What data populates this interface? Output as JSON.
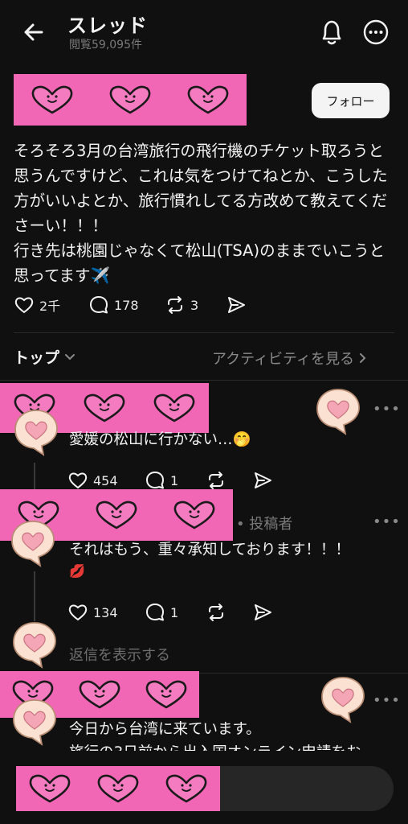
{
  "header": {
    "title": "スレッド",
    "subtitle": "閲覧59,095件"
  },
  "post": {
    "follow_label": "フォロー",
    "text": "そろそろ3月の台湾旅行の飛行機のチケット取ろうと思うんですけど、これは気をつけてねとか、こうした方がいいよとか、旅行慣れしてる方改めて教えてくださーい！！！\n行き先は桃園じゃなくて松山(TSA)のままでいこうと思ってます✈️",
    "likes": "2千",
    "replies": "178",
    "reposts": "3"
  },
  "sort_bar": {
    "top_label": "トップ",
    "activity_label": "アクティビティを見る"
  },
  "replies": [
    {
      "text": "愛媛の松山に行かない…🤭",
      "likes": "454",
      "comments": "1"
    },
    {
      "author_tag": "• 投稿者",
      "text": "それはもう、重々承知しております！！！",
      "emoji": "💋",
      "likes": "134",
      "comments": "1",
      "show_replies": "返信を表示する"
    },
    {
      "text": "今日から台湾に来ています。",
      "text_cut": "旅行の3日前から出入国オンライン申請をお"
    }
  ],
  "colors": {
    "background": "#101010",
    "redaction_pink": "#f266b6",
    "sticker_peach": "#fbe1d2"
  }
}
